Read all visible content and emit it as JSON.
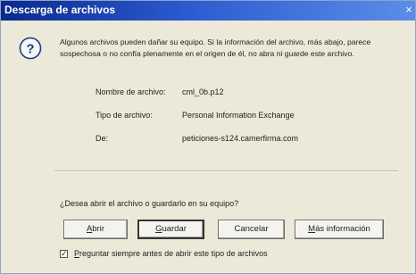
{
  "window": {
    "title": "Descarga de archivos",
    "close": "×"
  },
  "message": "Algunos archivos pueden dañar su equipo. Si la información del archivo, más abajo, parece sospechosa o no confía plenamente en el origen de él, no abra ni guarde este archivo.",
  "fields": {
    "name_label": "Nombre de archivo:",
    "name_value": "cml_0b.p12",
    "type_label": "Tipo de archivo:",
    "type_value": "Personal Information Exchange",
    "from_label": "De:",
    "from_value": "peticiones-s124.camerfirma.com"
  },
  "question": "¿Desea abrir el archivo o guardarlo en su equipo?",
  "buttons": {
    "open_u": "A",
    "open_rest": "brir",
    "save_u": "G",
    "save_rest": "uardar",
    "cancel": "Cancelar",
    "more_u": "M",
    "more_rest": "ás información"
  },
  "checkbox": {
    "checked": true,
    "label_u": "P",
    "label_rest": "reguntar siempre antes de abrir este tipo de archivos"
  },
  "icons": {
    "warning": "question-icon"
  }
}
